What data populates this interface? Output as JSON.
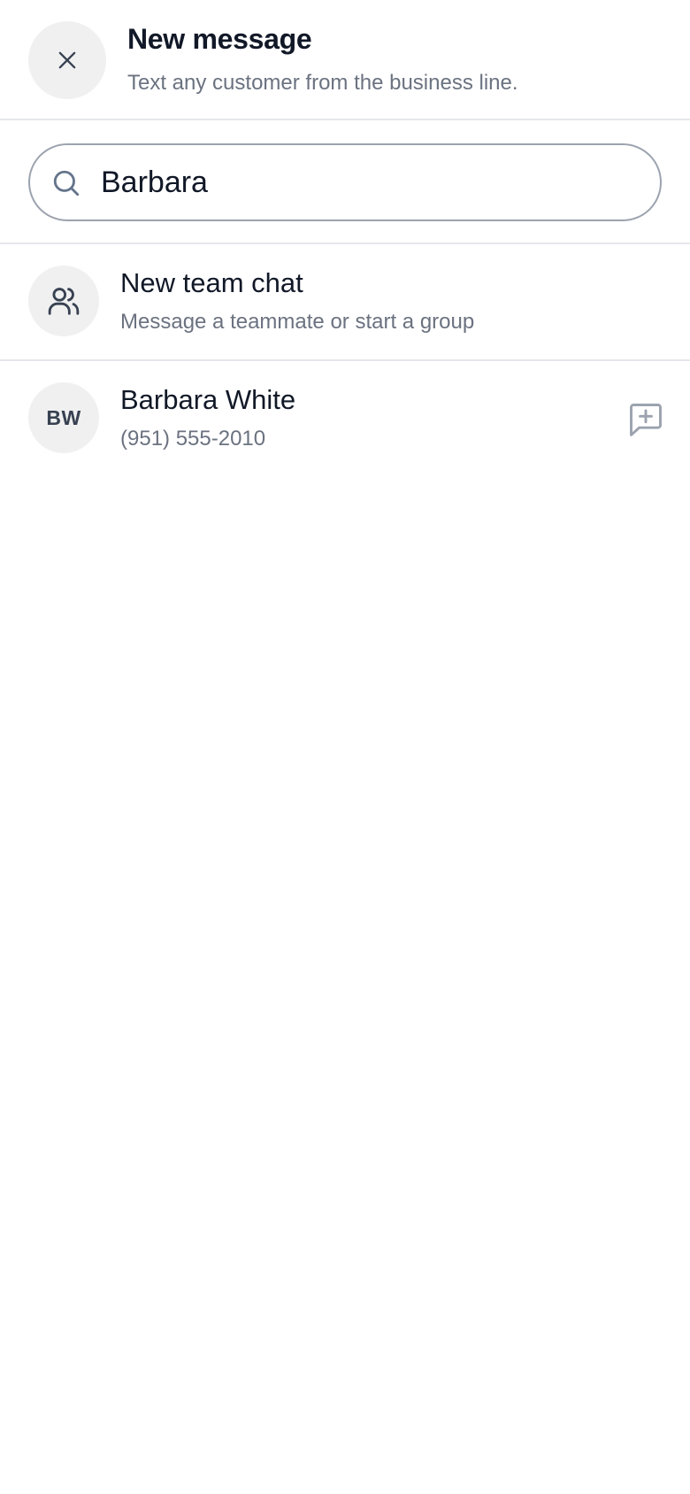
{
  "header": {
    "title": "New message",
    "subtitle": "Text any customer from the business line.",
    "close_icon": "close-icon"
  },
  "search": {
    "value": "Barbara",
    "placeholder": "",
    "icon": "search-icon"
  },
  "team_chat": {
    "title": "New team chat",
    "subtitle": "Message a teammate or start a group",
    "icon": "users-icon"
  },
  "results": [
    {
      "initials": "BW",
      "name": "Barbara White",
      "phone": "(951) 555-2010",
      "action_icon": "message-plus-icon"
    }
  ],
  "colors": {
    "text_primary": "#111827",
    "text_secondary": "#6b7280",
    "avatar_bg": "#f0f0f1",
    "divider": "#e5e7eb",
    "search_border": "#9ca3af"
  }
}
